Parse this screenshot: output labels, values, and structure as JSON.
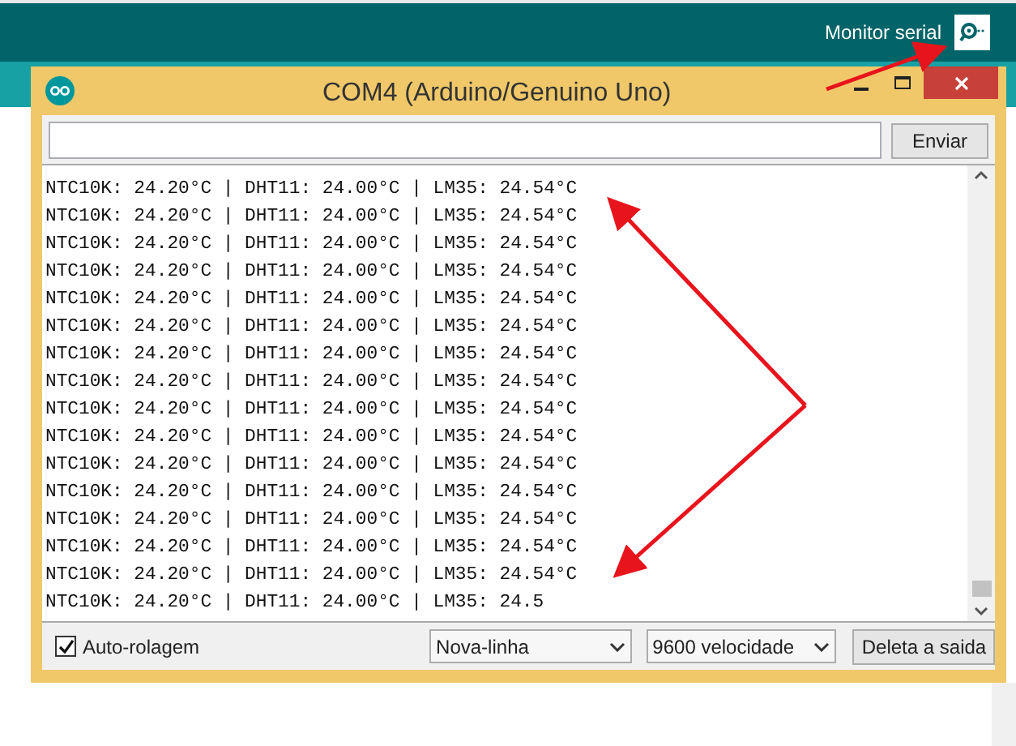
{
  "toolbar": {
    "serial_monitor_label": "Monitor serial"
  },
  "window": {
    "title": "COM4 (Arduino/Genuino Uno)"
  },
  "send_button": "Enviar",
  "output_lines": [
    "NTC10K: 24.20°C | DHT11: 24.00°C | LM35: 24.54°C",
    "NTC10K: 24.20°C | DHT11: 24.00°C | LM35: 24.54°C",
    "NTC10K: 24.20°C | DHT11: 24.00°C | LM35: 24.54°C",
    "NTC10K: 24.20°C | DHT11: 24.00°C | LM35: 24.54°C",
    "NTC10K: 24.20°C | DHT11: 24.00°C | LM35: 24.54°C",
    "NTC10K: 24.20°C | DHT11: 24.00°C | LM35: 24.54°C",
    "NTC10K: 24.20°C | DHT11: 24.00°C | LM35: 24.54°C",
    "NTC10K: 24.20°C | DHT11: 24.00°C | LM35: 24.54°C",
    "NTC10K: 24.20°C | DHT11: 24.00°C | LM35: 24.54°C",
    "NTC10K: 24.20°C | DHT11: 24.00°C | LM35: 24.54°C",
    "NTC10K: 24.20°C | DHT11: 24.00°C | LM35: 24.54°C",
    "NTC10K: 24.20°C | DHT11: 24.00°C | LM35: 24.54°C",
    "NTC10K: 24.20°C | DHT11: 24.00°C | LM35: 24.54°C",
    "NTC10K: 24.20°C | DHT11: 24.00°C | LM35: 24.54°C",
    "NTC10K: 24.20°C | DHT11: 24.00°C | LM35: 24.54°C",
    "NTC10K: 24.20°C | DHT11: 24.00°C | LM35: 24.5"
  ],
  "autoscroll": {
    "label": "Auto-rolagem",
    "checked": true
  },
  "line_ending": "Nova-linha",
  "baud_rate": "9600 velocidade",
  "clear_button": "Deleta a saida"
}
